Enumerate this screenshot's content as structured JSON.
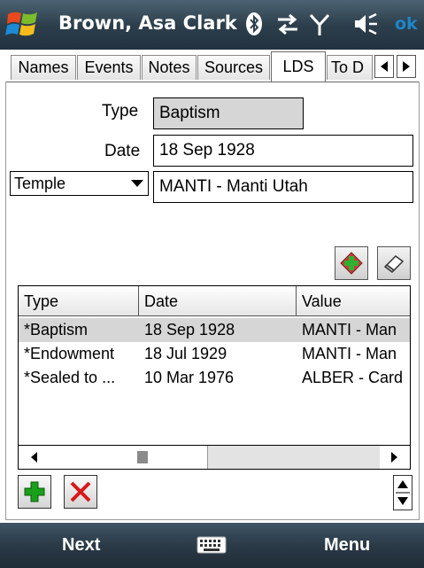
{
  "title_bar": {
    "title": "Brown, Asa Clark",
    "ok_label": "ok",
    "icons": [
      "windows-start-icon",
      "bluetooth-icon",
      "connectivity-arrows-icon",
      "signal-antenna-icon",
      "volume-icon"
    ]
  },
  "tabs": [
    {
      "label": "Names",
      "active": false
    },
    {
      "label": "Events",
      "active": false
    },
    {
      "label": "Notes",
      "active": false
    },
    {
      "label": "Sources",
      "active": false
    },
    {
      "label": "LDS",
      "active": true
    },
    {
      "label": "To D",
      "active": false
    }
  ],
  "form": {
    "type_label": "Type",
    "type_value": "Baptism",
    "date_label": "Date",
    "date_value": "18 Sep 1928",
    "place_dropdown": "Temple",
    "place_value": "MANTI - Manti Utah"
  },
  "list": {
    "columns": [
      "Type",
      "Date",
      "Value"
    ],
    "rows": [
      {
        "type": "*Baptism",
        "date": "18 Sep 1928",
        "value": "MANTI - Man",
        "selected": true
      },
      {
        "type": "*Endowment",
        "date": "18 Jul 1929",
        "value": "MANTI - Man",
        "selected": false
      },
      {
        "type": "*Sealed to ...",
        "date": "10 Mar 1976",
        "value": "ALBER - Card",
        "selected": false
      }
    ],
    "scroll_position": 0.0
  },
  "softkeys": {
    "left": "Next",
    "right": "Menu"
  },
  "colors": {
    "titlebar": "#2d3f4c",
    "ok": "#1e86c8",
    "add_green": "#1aa01a",
    "delete_red": "#d81818",
    "selected_row": "#d6d6d6"
  }
}
